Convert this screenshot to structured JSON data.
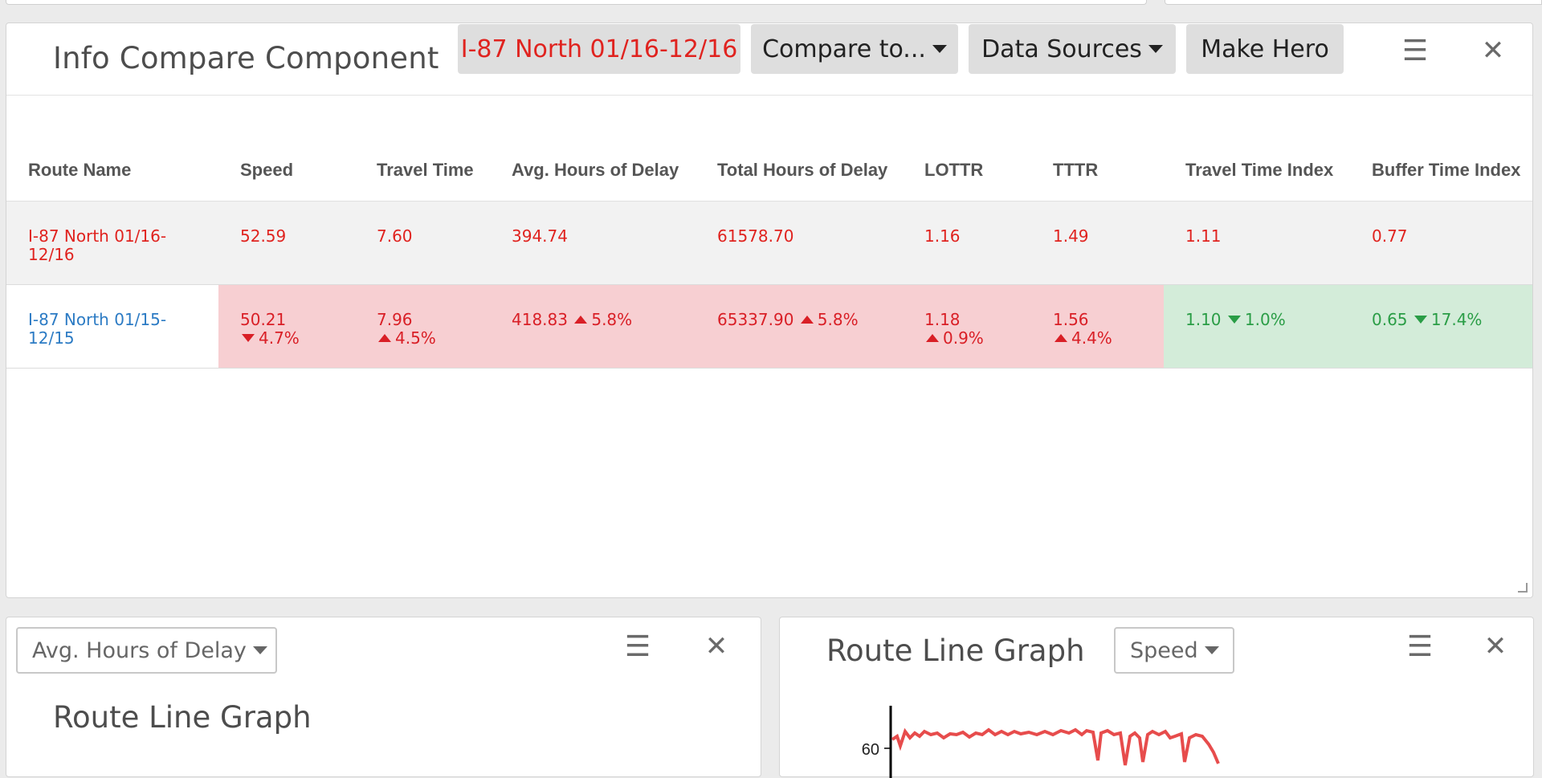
{
  "main_panel": {
    "title": "Info Compare Component",
    "route_button": "I-87 North 01/16-12/16",
    "compare_button": "Compare to...",
    "data_sources_button": "Data Sources",
    "make_hero_button": "Make Hero",
    "menu_icon": "hamburger-icon",
    "close_icon": "close-icon"
  },
  "table": {
    "headers": [
      "Route Name",
      "Speed",
      "Travel Time",
      "Avg. Hours of Delay",
      "Total Hours of Delay",
      "LOTTR",
      "TTTR",
      "Travel Time Index",
      "Buffer Time Index"
    ],
    "base_row": {
      "route_name": "I-87 North 01/16-12/16",
      "speed": "52.59",
      "travel_time": "7.60",
      "avg_hours_delay": "394.74",
      "total_hours_delay": "61578.70",
      "lottr": "1.16",
      "tttr": "1.49",
      "tti": "1.11",
      "bti": "0.77"
    },
    "compare_row": {
      "route_name": "I-87 North 01/15-12/15",
      "speed": {
        "value": "50.21",
        "change": "4.7%",
        "dir": "down"
      },
      "travel_time": {
        "value": "7.96",
        "change": "4.5%",
        "dir": "up"
      },
      "avg_hours_delay": {
        "value": "418.83",
        "change": "5.8%",
        "dir": "up"
      },
      "total_hours_delay": {
        "value": "65337.90",
        "change": "5.8%",
        "dir": "up"
      },
      "lottr": {
        "value": "1.18",
        "change": "0.9%",
        "dir": "up"
      },
      "tttr": {
        "value": "1.56",
        "change": "4.4%",
        "dir": "up"
      },
      "tti": {
        "value": "1.10",
        "change": "1.0%",
        "dir": "down"
      },
      "bti": {
        "value": "0.65",
        "change": "17.4%",
        "dir": "down"
      }
    }
  },
  "colors": {
    "base_text": "#e0231f",
    "compare_route_text": "#2c7bc4",
    "worse_bg": "#f7cfd2",
    "better_bg": "#d3ecd9",
    "better_text": "#2a9d46"
  },
  "bottom_left_panel": {
    "select_value": "Avg. Hours of Delay",
    "title": "Route Line Graph"
  },
  "bottom_right_panel": {
    "title": "Route Line Graph",
    "select_value": "Speed",
    "axis_tick": "60",
    "series_color": "#e74c4c"
  }
}
